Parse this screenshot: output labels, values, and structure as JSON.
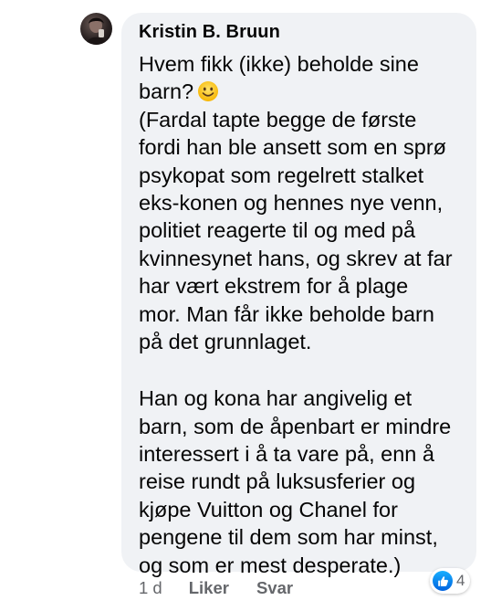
{
  "comment": {
    "author": "Kristin B. Bruun",
    "lines": [
      "Hvem fikk (ikke) beholde sine",
      "barn?",
      "(Fardal tapte begge de første",
      "fordi han ble ansett som en sprø",
      "psykopat som regelrett stalket",
      "eks-konen og hennes nye venn,",
      "politiet reagerte til og med på",
      "kvinnesynet hans, og skrev at far",
      "har vært ekstrem for å plage",
      "mor. Man får ikke beholde barn",
      "på det grunnlaget.",
      "",
      "Han og kona har angivelig et",
      "barn, som de åpenbart er mindre",
      "interessert i å ta vare på, enn å",
      "reise rundt på luksusferier og",
      "kjøpe Vuitton og Chanel for",
      "pengene til dem som har minst,",
      "og som er mest desperate.)"
    ],
    "emoji": "smiling-face-icon",
    "time": "1 d",
    "like_label": "Liker",
    "reply_label": "Svar",
    "reaction_icon": "like-thumb-icon",
    "reaction_count": "4",
    "colors": {
      "bubble": "#f0f2f5",
      "text": "#050505",
      "meta": "#65676b",
      "like_blue": "#1877f2"
    }
  }
}
